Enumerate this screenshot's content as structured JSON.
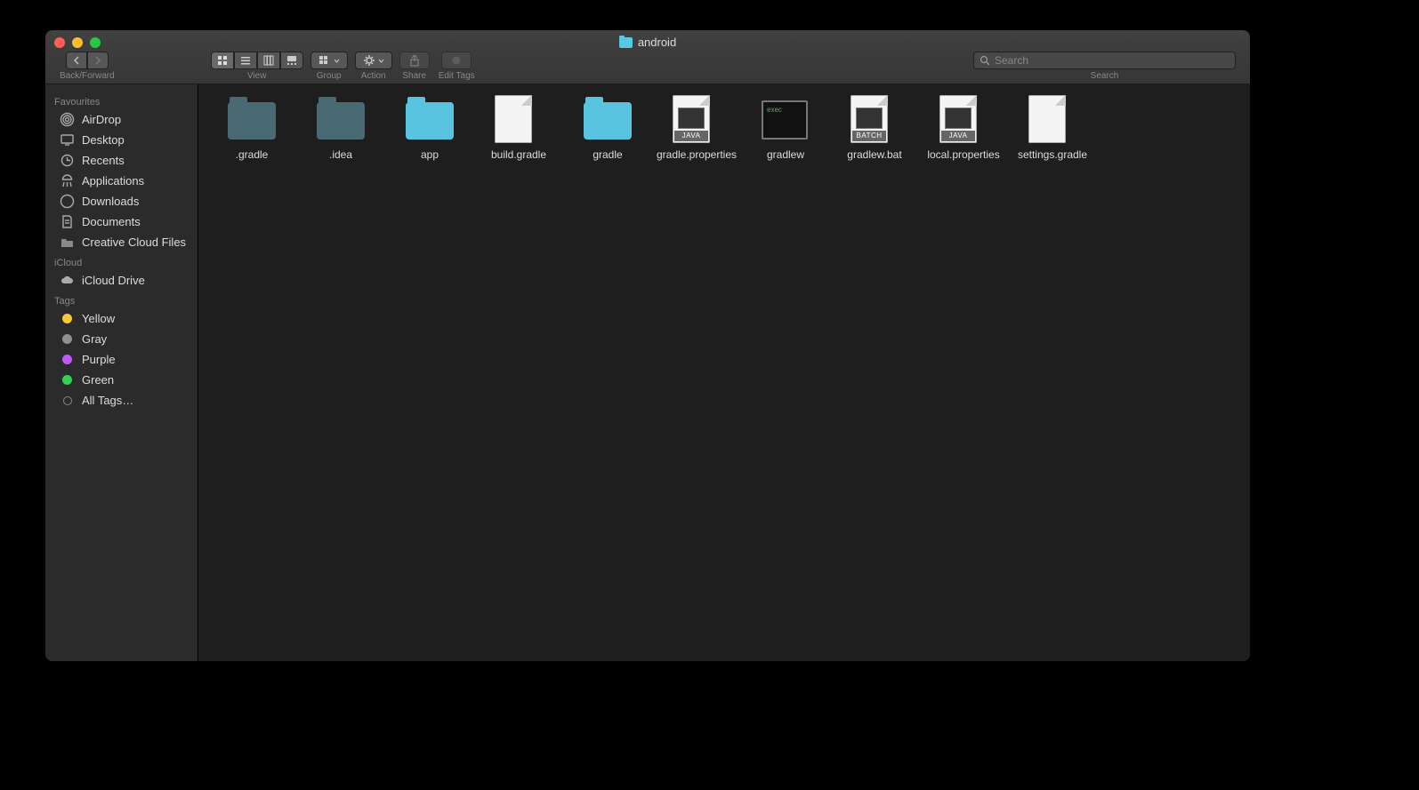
{
  "window": {
    "title": "android"
  },
  "toolbar": {
    "back_forward_label": "Back/Forward",
    "view_label": "View",
    "group_label": "Group",
    "action_label": "Action",
    "share_label": "Share",
    "edit_tags_label": "Edit Tags",
    "search_label": "Search",
    "search_placeholder": "Search"
  },
  "sidebar": {
    "sections": [
      {
        "title": "Favourites",
        "items": [
          {
            "label": "AirDrop",
            "icon": "airdrop"
          },
          {
            "label": "Desktop",
            "icon": "desktop"
          },
          {
            "label": "Recents",
            "icon": "recents"
          },
          {
            "label": "Applications",
            "icon": "apps"
          },
          {
            "label": "Downloads",
            "icon": "downloads"
          },
          {
            "label": "Documents",
            "icon": "documents"
          },
          {
            "label": "Creative Cloud Files",
            "icon": "folder"
          }
        ]
      },
      {
        "title": "iCloud",
        "items": [
          {
            "label": "iCloud Drive",
            "icon": "cloud"
          }
        ]
      },
      {
        "title": "Tags",
        "items": [
          {
            "label": "Yellow",
            "color": "#f5c93d"
          },
          {
            "label": "Gray",
            "color": "#8e8e93"
          },
          {
            "label": "Purple",
            "color": "#bf5af2"
          },
          {
            "label": "Green",
            "color": "#30d158"
          },
          {
            "label": "All Tags…",
            "hollow": true
          }
        ]
      }
    ]
  },
  "files": [
    {
      "name": ".gradle",
      "type": "folder-dim"
    },
    {
      "name": ".idea",
      "type": "folder-dim"
    },
    {
      "name": "app",
      "type": "folder-bright"
    },
    {
      "name": "build.gradle",
      "type": "doc"
    },
    {
      "name": "gradle",
      "type": "folder-bright"
    },
    {
      "name": "gradle.properties",
      "type": "java"
    },
    {
      "name": "gradlew",
      "type": "exec"
    },
    {
      "name": "gradlew.bat",
      "type": "batch"
    },
    {
      "name": "local.properties",
      "type": "java"
    },
    {
      "name": "settings.gradle",
      "type": "doc"
    }
  ],
  "file_badges": {
    "java": "JAVA",
    "batch": "BATCH",
    "exec": "exec"
  }
}
